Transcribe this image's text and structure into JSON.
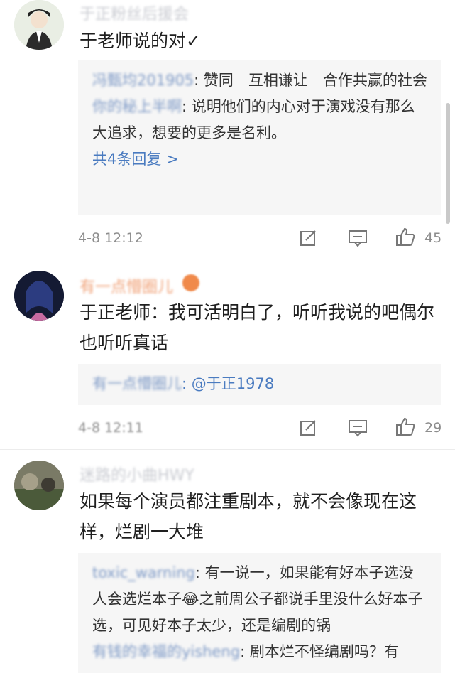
{
  "comments": [
    {
      "user": "于正粉丝后援会",
      "text": "于老师说的对✓",
      "replies": [
        {
          "name": "冯甄均201905",
          "text": ": 赞同　互相谦让　合作共赢的社会"
        },
        {
          "name": "你的秘上半啊",
          "text": ": 说明他们的内心对于演戏没有那么大追求，想要的更多是名利。"
        }
      ],
      "more_replies": "共4条回复 >",
      "time": "4-8 12:12",
      "likes": "45"
    },
    {
      "user": "有一点懵圈儿",
      "text": "于正老师：我可活明白了，听听我说的吧偶尔也听听真话",
      "replies": [
        {
          "name": "有一点懵圈儿",
          "text": ": @于正1978"
        }
      ],
      "time": "4-8 12:11",
      "likes": "29"
    },
    {
      "user": "迷路的小曲HWY",
      "text": "如果每个演员都注重剧本，就不会像现在这样，烂剧一大堆",
      "replies": [
        {
          "name": "toxic_warning",
          "text": ": 有一说一，如果能有好本子选没人会选烂本子😂之前周公子都说手里没什么好本子选，可见好本子太少，还是编剧的锅"
        },
        {
          "name": "有钱的幸福的yisheng",
          "text": ": 剧本烂不怪编剧吗？有"
        }
      ]
    }
  ],
  "icons": {
    "share": "share-icon",
    "comment": "comment-icon",
    "like": "thumbs-up-icon"
  },
  "colors": {
    "link": "#4a7bc0",
    "reply_bg": "#f6f6f6",
    "meta": "#8d8d8d"
  }
}
